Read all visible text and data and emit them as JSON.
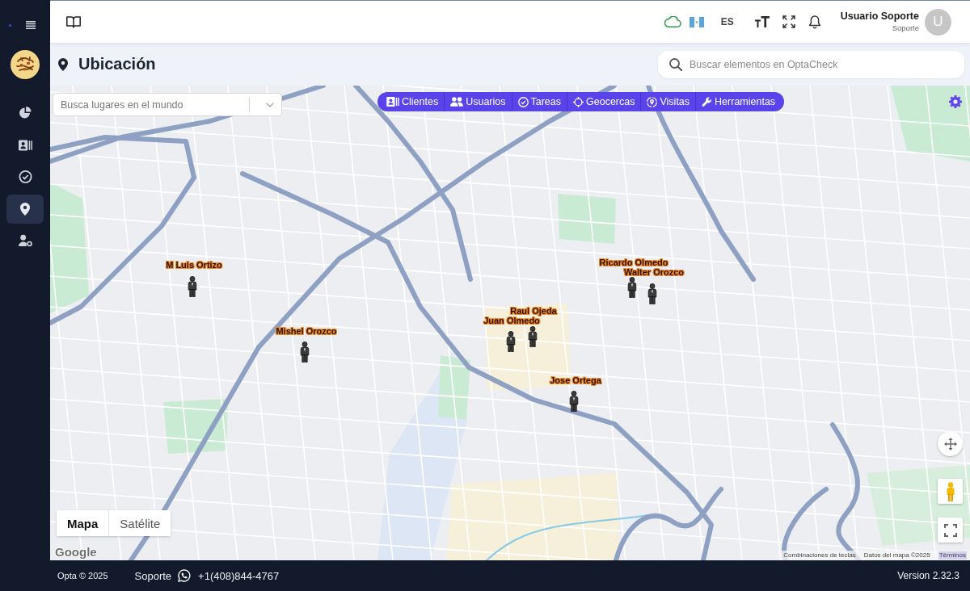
{
  "sidebar": {
    "items": [
      {
        "selected": false
      },
      {
        "selected": false
      },
      {
        "selected": false
      },
      {
        "selected": true
      },
      {
        "selected": false
      }
    ]
  },
  "header": {
    "language": "ES",
    "user": {
      "name": "Usuario Soporte",
      "role": "Soporte",
      "initial": "U"
    }
  },
  "page": {
    "title": "Ubicación",
    "search": {
      "placeholder": "Buscar elementos en OptaCheck"
    }
  },
  "map": {
    "place_search": {
      "placeholder": "Busca lugares en el mundo"
    },
    "toolbar": [
      "Clientes",
      "Usuarios",
      "Tareas",
      "Geocercas",
      "Visitas",
      "Herramientas"
    ],
    "markers": [
      "M Luis Ortizo",
      "Mishel Orozco",
      "Juan Olmedo",
      "Raul Ojeda",
      "Jose Ortega",
      "Ricardo Olmedo",
      "Walter Orozco"
    ],
    "map_types": [
      {
        "label": "Mapa",
        "selected": true
      },
      {
        "label": "Satélite",
        "selected": false
      }
    ],
    "logo": "Google",
    "attribution": [
      {
        "kind": "button",
        "text": "Combinaciones de teclas"
      },
      {
        "kind": "text",
        "text": "Datos del mapa ©2025"
      },
      {
        "kind": "link",
        "text": "Términos"
      }
    ]
  },
  "footer": {
    "copyright": "Opta © 2025",
    "support_label": "Soporte",
    "phone": "+1(408)844-4767",
    "version": "Version 2.32.3"
  }
}
